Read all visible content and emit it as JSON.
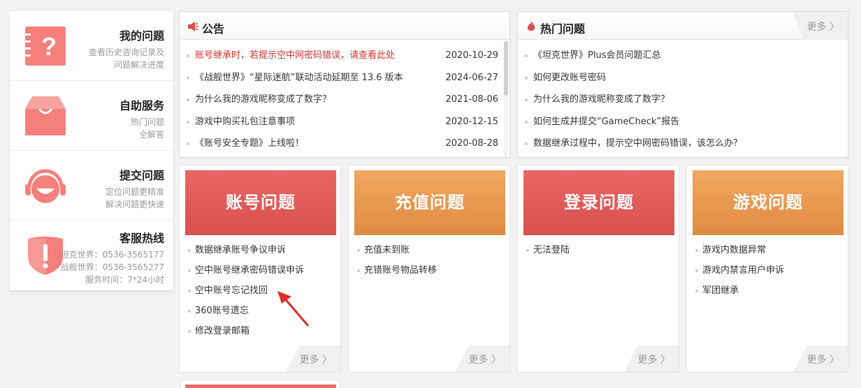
{
  "sidebar": {
    "items": [
      {
        "title": "我的问题",
        "desc1": "查看历史咨询记录及",
        "desc2": "问题解决进度",
        "icon": "question-doc-icon"
      },
      {
        "title": "自助服务",
        "desc1": "热门问题",
        "desc2": "全解答",
        "icon": "inbox-tray-icon"
      },
      {
        "title": "提交问题",
        "desc1": "定位问题更精准",
        "desc2": "解决问题更快速",
        "icon": "headset-icon"
      },
      {
        "title": "客服热线",
        "line1": "坦克世界：0536-3565177",
        "line2": "战舰世界：0536-3565277",
        "line3": "服务时间：7*24小时",
        "icon": "shield-alert-icon"
      }
    ]
  },
  "notice": {
    "title": "公告",
    "items": [
      {
        "text": "账号继承时，若提示空中网密码错误，请查看此处",
        "date": "2020-10-29"
      },
      {
        "text": "《战舰世界》“星际迷航”联动活动延期至 13.6 版本",
        "date": "2024-06-27"
      },
      {
        "text": "为什么我的游戏昵称变成了数字？",
        "date": "2021-08-06"
      },
      {
        "text": "游戏中购买礼包注意事项",
        "date": "2020-12-15"
      },
      {
        "text": "《账号安全专题》上线啦！",
        "date": "2020-08-28"
      }
    ]
  },
  "hot": {
    "title": "热门问题",
    "more": "更多 〉",
    "items": [
      "《坦克世界》Plus会员问题汇总",
      "如何更改账号密码",
      "为什么我的游戏昵称变成了数字？",
      "如何生成并提交“GameCheck”报告",
      "数据继承过程中，提示空中网密码错误，该怎么办？"
    ]
  },
  "categories": [
    {
      "title": "账号问题",
      "more": "更多 〉",
      "items": [
        "数据继承账号争议申诉",
        "空中账号继承密码错误申诉",
        "空中账号忘记找回",
        "360账号遗忘",
        "修改登录邮箱"
      ]
    },
    {
      "title": "充值问题",
      "more": "更多 〉",
      "items": [
        "充值未到账",
        "充错账号物品转移"
      ]
    },
    {
      "title": "登录问题",
      "more": "更多 〉",
      "items": [
        "无法登陆"
      ]
    },
    {
      "title": "游戏问题",
      "more": "更多 〉",
      "items": [
        "游戏内数据异常",
        "游戏内禁言用户申诉",
        "军团继承"
      ]
    }
  ],
  "colors": {
    "accent_red": "#d9504e",
    "accent_orange": "#e08a42",
    "highlight_text": "#d2322d"
  }
}
